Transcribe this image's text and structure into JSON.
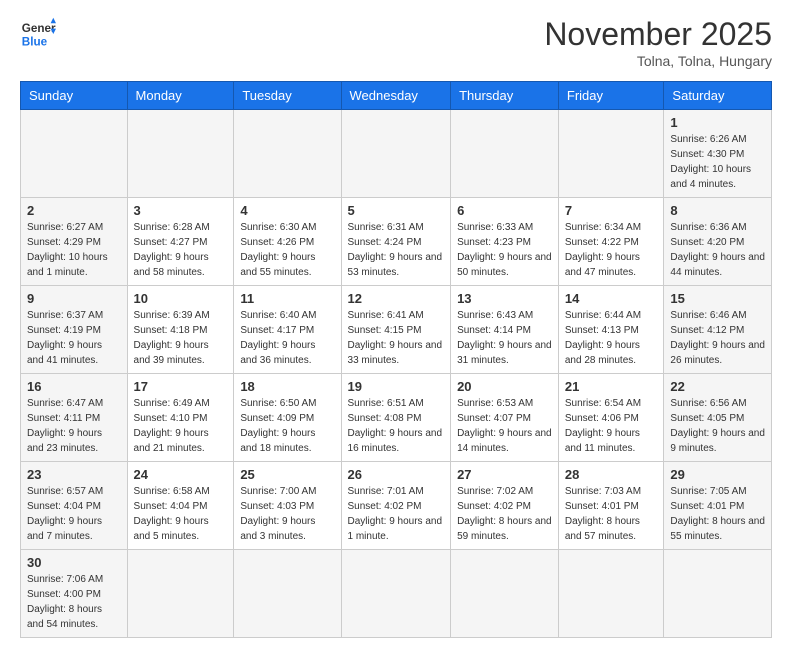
{
  "header": {
    "logo_general": "General",
    "logo_blue": "Blue",
    "month": "November 2025",
    "location": "Tolna, Tolna, Hungary"
  },
  "days_of_week": [
    "Sunday",
    "Monday",
    "Tuesday",
    "Wednesday",
    "Thursday",
    "Friday",
    "Saturday"
  ],
  "weeks": [
    [
      {
        "day": "",
        "info": ""
      },
      {
        "day": "",
        "info": ""
      },
      {
        "day": "",
        "info": ""
      },
      {
        "day": "",
        "info": ""
      },
      {
        "day": "",
        "info": ""
      },
      {
        "day": "",
        "info": ""
      },
      {
        "day": "1",
        "info": "Sunrise: 6:26 AM\nSunset: 4:30 PM\nDaylight: 10 hours and 4 minutes."
      }
    ],
    [
      {
        "day": "2",
        "info": "Sunrise: 6:27 AM\nSunset: 4:29 PM\nDaylight: 10 hours and 1 minute."
      },
      {
        "day": "3",
        "info": "Sunrise: 6:28 AM\nSunset: 4:27 PM\nDaylight: 9 hours and 58 minutes."
      },
      {
        "day": "4",
        "info": "Sunrise: 6:30 AM\nSunset: 4:26 PM\nDaylight: 9 hours and 55 minutes."
      },
      {
        "day": "5",
        "info": "Sunrise: 6:31 AM\nSunset: 4:24 PM\nDaylight: 9 hours and 53 minutes."
      },
      {
        "day": "6",
        "info": "Sunrise: 6:33 AM\nSunset: 4:23 PM\nDaylight: 9 hours and 50 minutes."
      },
      {
        "day": "7",
        "info": "Sunrise: 6:34 AM\nSunset: 4:22 PM\nDaylight: 9 hours and 47 minutes."
      },
      {
        "day": "8",
        "info": "Sunrise: 6:36 AM\nSunset: 4:20 PM\nDaylight: 9 hours and 44 minutes."
      }
    ],
    [
      {
        "day": "9",
        "info": "Sunrise: 6:37 AM\nSunset: 4:19 PM\nDaylight: 9 hours and 41 minutes."
      },
      {
        "day": "10",
        "info": "Sunrise: 6:39 AM\nSunset: 4:18 PM\nDaylight: 9 hours and 39 minutes."
      },
      {
        "day": "11",
        "info": "Sunrise: 6:40 AM\nSunset: 4:17 PM\nDaylight: 9 hours and 36 minutes."
      },
      {
        "day": "12",
        "info": "Sunrise: 6:41 AM\nSunset: 4:15 PM\nDaylight: 9 hours and 33 minutes."
      },
      {
        "day": "13",
        "info": "Sunrise: 6:43 AM\nSunset: 4:14 PM\nDaylight: 9 hours and 31 minutes."
      },
      {
        "day": "14",
        "info": "Sunrise: 6:44 AM\nSunset: 4:13 PM\nDaylight: 9 hours and 28 minutes."
      },
      {
        "day": "15",
        "info": "Sunrise: 6:46 AM\nSunset: 4:12 PM\nDaylight: 9 hours and 26 minutes."
      }
    ],
    [
      {
        "day": "16",
        "info": "Sunrise: 6:47 AM\nSunset: 4:11 PM\nDaylight: 9 hours and 23 minutes."
      },
      {
        "day": "17",
        "info": "Sunrise: 6:49 AM\nSunset: 4:10 PM\nDaylight: 9 hours and 21 minutes."
      },
      {
        "day": "18",
        "info": "Sunrise: 6:50 AM\nSunset: 4:09 PM\nDaylight: 9 hours and 18 minutes."
      },
      {
        "day": "19",
        "info": "Sunrise: 6:51 AM\nSunset: 4:08 PM\nDaylight: 9 hours and 16 minutes."
      },
      {
        "day": "20",
        "info": "Sunrise: 6:53 AM\nSunset: 4:07 PM\nDaylight: 9 hours and 14 minutes."
      },
      {
        "day": "21",
        "info": "Sunrise: 6:54 AM\nSunset: 4:06 PM\nDaylight: 9 hours and 11 minutes."
      },
      {
        "day": "22",
        "info": "Sunrise: 6:56 AM\nSunset: 4:05 PM\nDaylight: 9 hours and 9 minutes."
      }
    ],
    [
      {
        "day": "23",
        "info": "Sunrise: 6:57 AM\nSunset: 4:04 PM\nDaylight: 9 hours and 7 minutes."
      },
      {
        "day": "24",
        "info": "Sunrise: 6:58 AM\nSunset: 4:04 PM\nDaylight: 9 hours and 5 minutes."
      },
      {
        "day": "25",
        "info": "Sunrise: 7:00 AM\nSunset: 4:03 PM\nDaylight: 9 hours and 3 minutes."
      },
      {
        "day": "26",
        "info": "Sunrise: 7:01 AM\nSunset: 4:02 PM\nDaylight: 9 hours and 1 minute."
      },
      {
        "day": "27",
        "info": "Sunrise: 7:02 AM\nSunset: 4:02 PM\nDaylight: 8 hours and 59 minutes."
      },
      {
        "day": "28",
        "info": "Sunrise: 7:03 AM\nSunset: 4:01 PM\nDaylight: 8 hours and 57 minutes."
      },
      {
        "day": "29",
        "info": "Sunrise: 7:05 AM\nSunset: 4:01 PM\nDaylight: 8 hours and 55 minutes."
      }
    ],
    [
      {
        "day": "30",
        "info": "Sunrise: 7:06 AM\nSunset: 4:00 PM\nDaylight: 8 hours and 54 minutes."
      },
      {
        "day": "",
        "info": ""
      },
      {
        "day": "",
        "info": ""
      },
      {
        "day": "",
        "info": ""
      },
      {
        "day": "",
        "info": ""
      },
      {
        "day": "",
        "info": ""
      },
      {
        "day": "",
        "info": ""
      }
    ]
  ]
}
